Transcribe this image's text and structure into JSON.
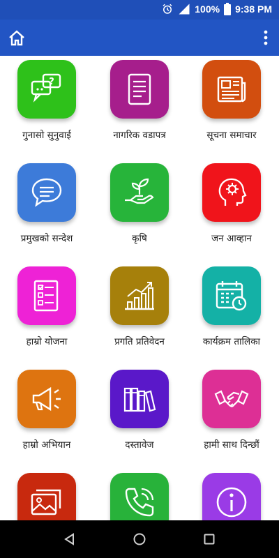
{
  "status_bar": {
    "battery": "100%",
    "time": "9:38 PM"
  },
  "app_bar": {
    "home_icon": "home-icon",
    "menu_icon": "more-vert-icon"
  },
  "tiles": [
    {
      "label": "गुनासो सुनुवाई",
      "color": "#2ec11a",
      "icon": "chat-question-icon"
    },
    {
      "label": "नागरिक वडापत्र",
      "color": "#a61e8c",
      "icon": "document-list-icon"
    },
    {
      "label": "सूचना समाचार",
      "color": "#d24e0f",
      "icon": "newspaper-icon"
    },
    {
      "label": "प्रमुखको सन्देश",
      "color": "#3d7bd9",
      "icon": "message-bubble-icon"
    },
    {
      "label": "कृषि",
      "color": "#27b43a",
      "icon": "plant-hand-icon"
    },
    {
      "label": "जन आव्हान",
      "color": "#f0141b",
      "icon": "head-gear-icon"
    },
    {
      "label": "हाम्रो योजना",
      "color": "#ee22d6",
      "icon": "checklist-icon"
    },
    {
      "label": "प्रगति प्रतिवेदन",
      "color": "#a6800b",
      "icon": "growth-chart-icon"
    },
    {
      "label": "कार्यक्रम तालिका",
      "color": "#14b1a6",
      "icon": "calendar-clock-icon"
    },
    {
      "label": "हाम्रो अभियान",
      "color": "#de7410",
      "icon": "megaphone-icon"
    },
    {
      "label": "दस्तावेज",
      "color": "#5a18c9",
      "icon": "books-icon"
    },
    {
      "label": "हामी साथ दिन्छौं",
      "color": "#dd2f95",
      "icon": "handshake-icon"
    },
    {
      "label": "",
      "color": "#c8290e",
      "icon": "gallery-icon"
    },
    {
      "label": "",
      "color": "#28b23a",
      "icon": "phone-call-icon"
    },
    {
      "label": "",
      "color": "#9a3be6",
      "icon": "info-icon"
    }
  ]
}
